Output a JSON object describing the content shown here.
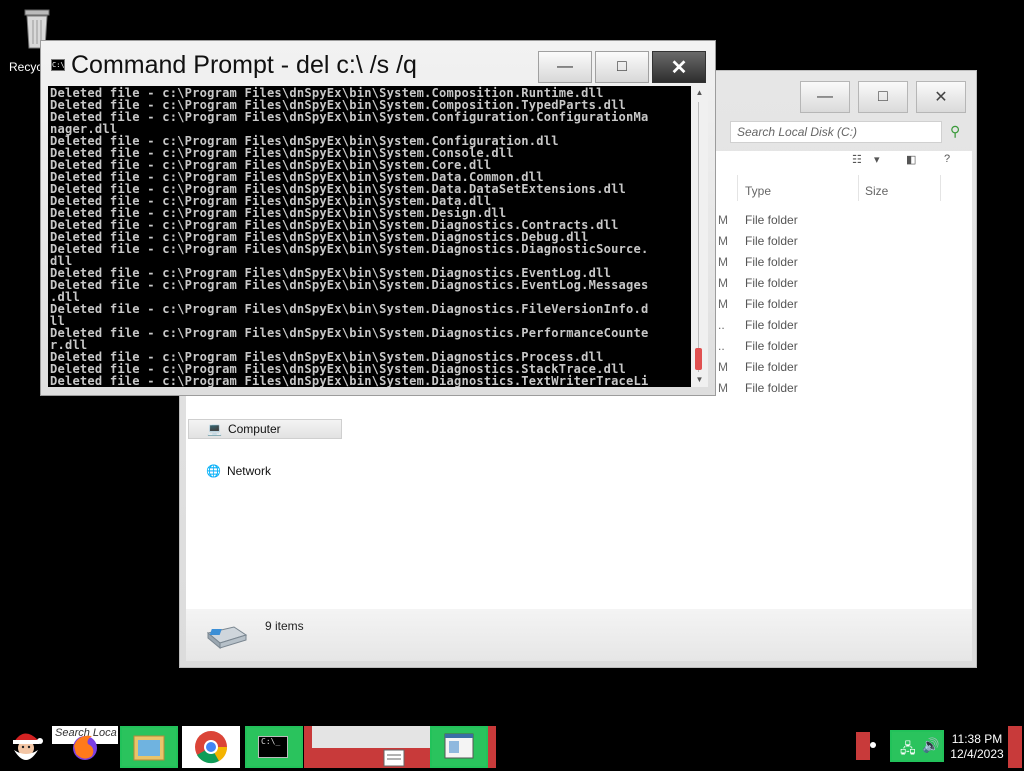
{
  "desktop": {
    "recycle_label": "Recyc"
  },
  "cmd": {
    "title": "Command Prompt - del  c:\\ /s /q",
    "lines": [
      "Deleted file - c:\\Program Files\\dnSpyEx\\bin\\System.Composition.Runtime.dll",
      "Deleted file - c:\\Program Files\\dnSpyEx\\bin\\System.Composition.TypedParts.dll",
      "Deleted file - c:\\Program Files\\dnSpyEx\\bin\\System.Configuration.ConfigurationMa",
      "nager.dll",
      "Deleted file - c:\\Program Files\\dnSpyEx\\bin\\System.Configuration.dll",
      "Deleted file - c:\\Program Files\\dnSpyEx\\bin\\System.Console.dll",
      "Deleted file - c:\\Program Files\\dnSpyEx\\bin\\System.Core.dll",
      "Deleted file - c:\\Program Files\\dnSpyEx\\bin\\System.Data.Common.dll",
      "Deleted file - c:\\Program Files\\dnSpyEx\\bin\\System.Data.DataSetExtensions.dll",
      "Deleted file - c:\\Program Files\\dnSpyEx\\bin\\System.Data.dll",
      "Deleted file - c:\\Program Files\\dnSpyEx\\bin\\System.Design.dll",
      "Deleted file - c:\\Program Files\\dnSpyEx\\bin\\System.Diagnostics.Contracts.dll",
      "Deleted file - c:\\Program Files\\dnSpyEx\\bin\\System.Diagnostics.Debug.dll",
      "Deleted file - c:\\Program Files\\dnSpyEx\\bin\\System.Diagnostics.DiagnosticSource.",
      "dll",
      "Deleted file - c:\\Program Files\\dnSpyEx\\bin\\System.Diagnostics.EventLog.dll",
      "Deleted file - c:\\Program Files\\dnSpyEx\\bin\\System.Diagnostics.EventLog.Messages",
      ".dll",
      "Deleted file - c:\\Program Files\\dnSpyEx\\bin\\System.Diagnostics.FileVersionInfo.d",
      "ll",
      "Deleted file - c:\\Program Files\\dnSpyEx\\bin\\System.Diagnostics.PerformanceCounte",
      "r.dll",
      "Deleted file - c:\\Program Files\\dnSpyEx\\bin\\System.Diagnostics.Process.dll",
      "Deleted file - c:\\Program Files\\dnSpyEx\\bin\\System.Diagnostics.StackTrace.dll",
      "Deleted file - c:\\Program Files\\dnSpyEx\\bin\\System.Diagnostics.TextWriterTraceLi"
    ]
  },
  "explorer": {
    "search_placeholder": "Search Local Disk (C:)",
    "columns": {
      "type": "Type",
      "size": "Size"
    },
    "rows": [
      {
        "date_tail": "M",
        "type": "File folder"
      },
      {
        "date_tail": "M",
        "type": "File folder"
      },
      {
        "date_tail": "M",
        "type": "File folder"
      },
      {
        "date_tail": "M",
        "type": "File folder"
      },
      {
        "date_tail": "M",
        "type": "File folder"
      },
      {
        "date_tail": "..",
        "type": "File folder"
      },
      {
        "date_tail": "..",
        "type": "File folder"
      },
      {
        "date_tail": "M",
        "type": "File folder"
      },
      {
        "date_tail": "M",
        "type": "File folder"
      }
    ],
    "nav": {
      "computer": "Computer",
      "network": "Network"
    },
    "status": "9 items"
  },
  "taskbar": {
    "search_text": "Search Loca",
    "time": "11:38 PM",
    "date": "12/4/2023"
  }
}
